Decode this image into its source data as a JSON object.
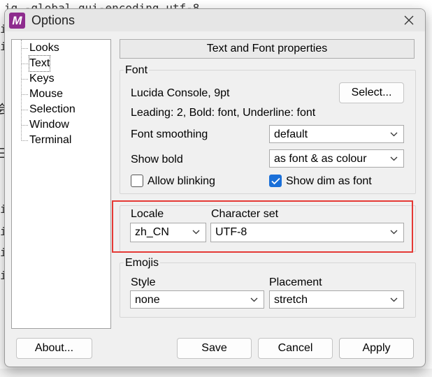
{
  "background": {
    "line1": "ig -global gui-encoding utf-8",
    "left_chars": [
      "i",
      "i",
      "i",
      "i",
      "i",
      "i"
    ],
    "left_glyphs": [
      "会",
      "三"
    ]
  },
  "dialog": {
    "title": "Options",
    "app_icon_letter": "M"
  },
  "tree": {
    "items": [
      "Looks",
      "Text",
      "Keys",
      "Mouse",
      "Selection",
      "Window",
      "Terminal"
    ],
    "selected": "Text"
  },
  "header": {
    "label": "Text and Font properties"
  },
  "font_group": {
    "title": "Font",
    "font_name": "Lucida Console, 9pt",
    "select_button": "Select...",
    "details": "Leading: 2, Bold: font, Underline: font",
    "smoothing_label": "Font smoothing",
    "smoothing_value": "default",
    "show_bold_label": "Show bold",
    "show_bold_value": "as font & as colour",
    "allow_blinking_label": "Allow blinking",
    "allow_blinking_checked": false,
    "show_dim_label": "Show dim as font",
    "show_dim_checked": true
  },
  "locale_group": {
    "locale_label": "Locale",
    "locale_value": "zh_CN",
    "charset_label": "Character set",
    "charset_value": "UTF-8"
  },
  "emojis_group": {
    "title": "Emojis",
    "style_label": "Style",
    "style_value": "none",
    "placement_label": "Placement",
    "placement_value": "stretch"
  },
  "buttons": {
    "about": "About...",
    "save": "Save",
    "cancel": "Cancel",
    "apply": "Apply"
  },
  "colors": {
    "accent": "#1a6fd8",
    "highlight": "#e53935",
    "app_icon": "#8e2c8e"
  }
}
